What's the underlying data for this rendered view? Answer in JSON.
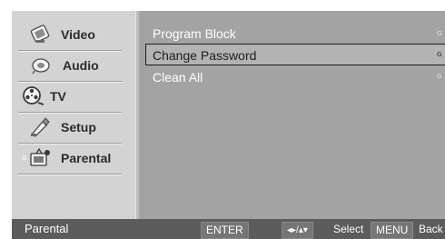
{
  "sidebar": {
    "items": [
      {
        "label": "Video",
        "icon": "video-icon"
      },
      {
        "label": "Audio",
        "icon": "audio-icon"
      },
      {
        "label": "TV",
        "icon": "tv-reel-icon"
      },
      {
        "label": "Setup",
        "icon": "setup-icon"
      },
      {
        "label": "Parental",
        "icon": "parental-icon"
      }
    ],
    "marker": "G"
  },
  "main": {
    "items": [
      {
        "label": "Program Block",
        "marker": "G"
      },
      {
        "label": "Change Password",
        "marker": "G"
      },
      {
        "label": "Clean All",
        "marker": "G"
      }
    ],
    "selected_index": 1
  },
  "status": {
    "title": "Parental",
    "enter_key": "ENTER",
    "nav_key": "◂▸/▴▾",
    "select_label": "Select",
    "menu_key": "MENU",
    "back_label": "Back"
  },
  "colors": {
    "sidebar_bg": "#d3d3d3",
    "main_bg": "#a3a3a3",
    "status_bg": "#5c5c5c",
    "selected_text": "#1e1e1e",
    "menu_text": "#ffffff"
  }
}
